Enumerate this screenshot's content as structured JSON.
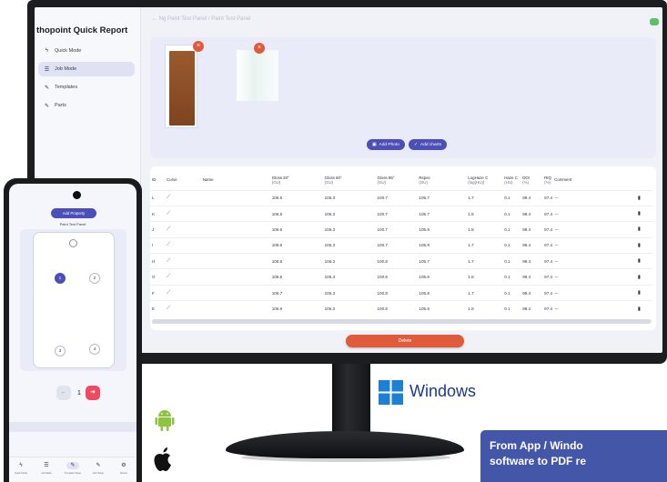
{
  "app": {
    "title": "thopoint Quick Report",
    "top_text": "← Ng Paint Test Panel / Paint Test Panel",
    "sidebar": [
      {
        "label": "Quick Mode",
        "icon": "bolt-icon"
      },
      {
        "label": "Job Mode",
        "icon": "list-icon",
        "active": true
      },
      {
        "label": "Templates",
        "icon": "magic-icon"
      },
      {
        "label": "Parts",
        "icon": "magic-icon"
      }
    ],
    "photo_buttons": {
      "add_photo": "Add Photo",
      "add_charts": "Add charts"
    },
    "table": {
      "headers": [
        {
          "l1": "ID",
          "l2": ""
        },
        {
          "l1": "Curve",
          "l2": ""
        },
        {
          "l1": "Name",
          "l2": ""
        },
        {
          "l1": "Gloss 20°",
          "l2": "(GU)"
        },
        {
          "l1": "Gloss 60°",
          "l2": "(GU)"
        },
        {
          "l1": "Gloss 85°",
          "l2": "(GU)"
        },
        {
          "l1": "Rspec",
          "l2": "(GU)"
        },
        {
          "l1": "LogHaze C",
          "l2": "(log(HU))"
        },
        {
          "l1": "Haze C",
          "l2": "(HU)"
        },
        {
          "l1": "DOI",
          "l2": "(%)"
        },
        {
          "l1": "RIQ",
          "l2": "(%)"
        },
        {
          "l1": "Comment",
          "l2": ""
        }
      ],
      "rows": [
        {
          "id": "L",
          "g20": "106.5",
          "g60": "105.3",
          "g85": "100.7",
          "rspec": "105.7",
          "loghaze": "1.7",
          "haze": "0.1",
          "doi": "99.4",
          "riq": "97.4",
          "comment": "---"
        },
        {
          "id": "K",
          "g20": "106.5",
          "g60": "105.3",
          "g85": "100.7",
          "rspec": "105.7",
          "loghaze": "1.8",
          "haze": "0.1",
          "doi": "99.4",
          "riq": "97.4",
          "comment": "---"
        },
        {
          "id": "J",
          "g20": "106.6",
          "g60": "105.3",
          "g85": "100.7",
          "rspec": "105.8",
          "loghaze": "1.8",
          "haze": "0.1",
          "doi": "99.4",
          "riq": "97.4",
          "comment": "---"
        },
        {
          "id": "I",
          "g20": "106.6",
          "g60": "105.3",
          "g85": "100.7",
          "rspec": "105.8",
          "loghaze": "1.7",
          "haze": "0.1",
          "doi": "99.4",
          "riq": "97.4",
          "comment": "---"
        },
        {
          "id": "H",
          "g20": "106.5",
          "g60": "105.3",
          "g85": "100.8",
          "rspec": "105.7",
          "loghaze": "1.7",
          "haze": "0.1",
          "doi": "99.4",
          "riq": "97.4",
          "comment": "---"
        },
        {
          "id": "G",
          "g20": "106.5",
          "g60": "105.3",
          "g85": "100.8",
          "rspec": "105.8",
          "loghaze": "1.8",
          "haze": "0.1",
          "doi": "99.4",
          "riq": "97.4",
          "comment": "---"
        },
        {
          "id": "F",
          "g20": "106.7",
          "g60": "105.3",
          "g85": "100.8",
          "rspec": "105.8",
          "loghaze": "1.7",
          "haze": "0.1",
          "doi": "99.4",
          "riq": "97.4",
          "comment": "---"
        },
        {
          "id": "E",
          "g20": "106.6",
          "g60": "105.3",
          "g85": "100.8",
          "rspec": "105.8",
          "loghaze": "1.8",
          "haze": "0.1",
          "doi": "99.4",
          "riq": "97.4",
          "comment": "---"
        }
      ]
    },
    "delete_label": "Delete"
  },
  "phone": {
    "add_property": "Add Property",
    "panel_title": "Paint Test Panel",
    "points": [
      "1",
      "2",
      "3",
      "4"
    ],
    "active_point": "1",
    "page": "1",
    "nav": [
      {
        "icon": "bolt-icon",
        "label": "Quick Mode"
      },
      {
        "icon": "list-icon",
        "label": "Job Mode"
      },
      {
        "icon": "magic-icon",
        "label": "Template Setup"
      },
      {
        "icon": "magic-icon",
        "label": "Part Setup"
      },
      {
        "icon": "gear-icon",
        "label": "Device"
      }
    ]
  },
  "platforms": {
    "windows_label": "Windows",
    "logos": [
      "windows-logo",
      "android-logo",
      "apple-logo"
    ],
    "windows_blue": "#1e7fd6",
    "android_green": "#8cc43f"
  },
  "caption": {
    "line1": "From App / Windo",
    "line2": "software to PDF re"
  },
  "colors": {
    "accent": "#4b4fb8",
    "danger": "#e05a3c",
    "next_button": "#ef4a5f",
    "caption_bg": "#4456a8"
  }
}
